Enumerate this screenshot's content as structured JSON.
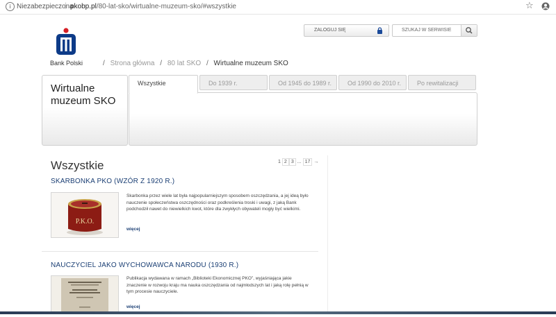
{
  "browser": {
    "security_label": "Niezabezpieczona",
    "url_domain": "pkobp.pl",
    "url_path": "/80-lat-sko/wirtualne-muzeum-sko/#wszystkie"
  },
  "header": {
    "brand": "Bank Polski",
    "login_label": "ZALOGUJ SIĘ",
    "search_placeholder": "SZUKAJ W SERWISIE"
  },
  "breadcrumb": {
    "items": [
      "Strona główna",
      "80 lat SKO",
      "Wirtualne muzeum SKO"
    ]
  },
  "museum": {
    "title_line1": "Wirtualne",
    "title_line2": "muzeum SKO"
  },
  "tabs": [
    {
      "label": "Wszystkie",
      "active": true
    },
    {
      "label": "Do 1939 r."
    },
    {
      "label": "Od 1945 do 1989 r."
    },
    {
      "label": "Od 1990 do 2010 r."
    },
    {
      "label": "Po rewitalizacji"
    }
  ],
  "main": {
    "heading": "Wszystkie",
    "pagination": {
      "p1": "1",
      "p2": "2",
      "p3": "3",
      "ellipsis": "...",
      "last": "17",
      "next": "→"
    }
  },
  "articles": [
    {
      "title": "SKARBONKA PKO (WZÓR Z 1920 R.)",
      "description": "Skarbonka przez wiele lat była najpopularniejszym sposobem oszczędzania, a jej ideą było nauczenie społeczeństwa oszczędności oraz podkreślenia troski i uwagi, z jaką Bank podchodził nawet do niewielkich kwot, które dla zwykłych obywateli mogły być wielkimi.",
      "more": "więcej",
      "thumb_text": "P.K.O."
    },
    {
      "title": "NAUCZYCIEL JAKO WYCHOWAWCA NARODU (1930 R.)",
      "description": "Publikacja wydawana w ramach „Biblioteki Ekonomicznej PKO”, wyjaśniająca jakie znaczenie w rozwoju kraju ma nauka oszczędzania od najmłodszych lat i jaką rolę pełnią w tym procesie nauczyciele.",
      "more": "więcej"
    }
  ]
}
